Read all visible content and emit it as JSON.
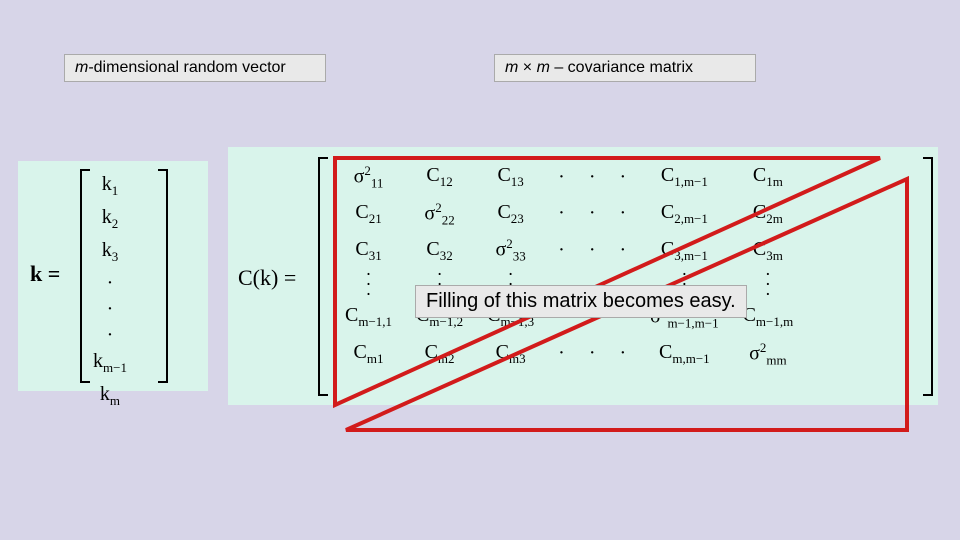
{
  "labels": {
    "left_html": "<em>m</em>-dimensional random vector",
    "right_html": "<em>m</em> × <em>m</em> – covariance matrix"
  },
  "vector_eq_lhs": "k =",
  "vector_entries": [
    "k₁",
    "k₂",
    "k₃",
    "·",
    "·",
    "·",
    "kₘ₋₁",
    "kₘ"
  ],
  "matrix_eq_lhs": "C(k) =",
  "matrix": {
    "rows": [
      [
        "σ²₁₁",
        "C₁₂",
        "C₁₃",
        "·",
        "·",
        "·",
        "C₁,ₘ₋₁",
        "C₁ₘ"
      ],
      [
        "C₂₁",
        "σ²₂₂",
        "C₂₃",
        "·",
        "·",
        "·",
        "C₂,ₘ₋₁",
        "C₂ₘ"
      ],
      [
        "C₃₁",
        "C₃₂",
        "σ²₃₃",
        "·",
        "·",
        "·",
        "C₃,ₘ₋₁",
        "C₃ₘ"
      ],
      [
        "·",
        "·",
        "·",
        "",
        "",
        "",
        "·",
        "·"
      ],
      [
        "·",
        "·",
        "·",
        "",
        "",
        "",
        "·",
        "·"
      ],
      [
        "·",
        "·",
        "·",
        "",
        "",
        "",
        "·",
        "·"
      ],
      [
        "Cₘ₋₁,₁",
        "Cₘ₋₁,₂",
        "Cₘ₋₁,₃",
        "·",
        "·",
        "·",
        "σ²ₘ₋₁,ₘ₋₁",
        "Cₘ₋₁,ₘ"
      ],
      [
        "Cₘ₁",
        "Cₘ₂",
        "Cₘ₃",
        "·",
        "·",
        "·",
        "Cₘ,ₘ₋₁",
        "σ²ₘₘ"
      ]
    ]
  },
  "callout": "Filling of this matrix becomes easy."
}
